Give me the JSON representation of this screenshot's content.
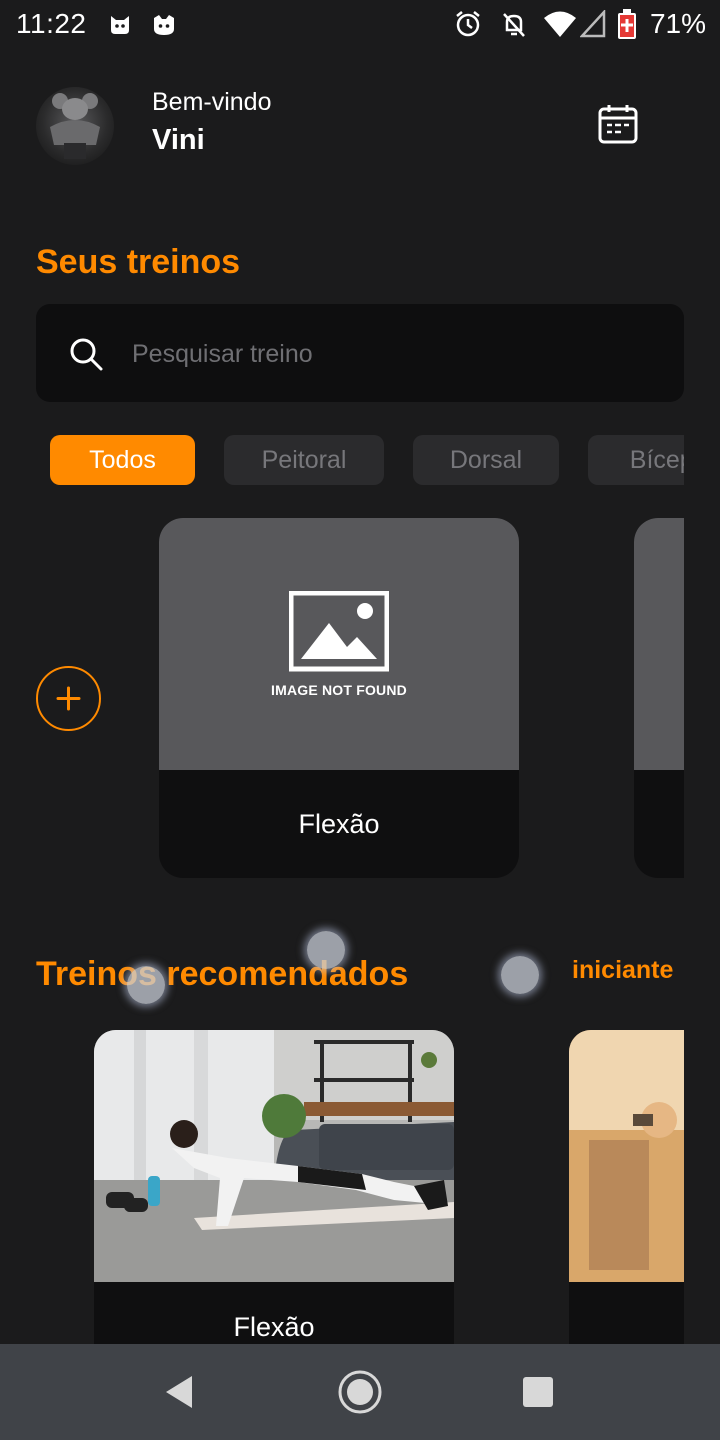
{
  "status_bar": {
    "time": "11:22",
    "battery": "71%",
    "icons": [
      "cat-notification-icon",
      "cat-notification-icon",
      "alarm-icon",
      "notifications-off-icon",
      "wifi-icon",
      "signal-icon",
      "battery-icon"
    ]
  },
  "header": {
    "welcome": "Bem-vindo",
    "user_name": "Vini",
    "calendar_icon": "calendar-icon"
  },
  "workouts": {
    "title": "Seus treinos",
    "search": {
      "placeholder": "Pesquisar treino",
      "value": ""
    },
    "chips": [
      {
        "label": "Todos",
        "active": true
      },
      {
        "label": "Peitoral",
        "active": false
      },
      {
        "label": "Dorsal",
        "active": false
      },
      {
        "label": "Bíceps",
        "active": false
      }
    ],
    "add_icon": "plus-icon",
    "cards": [
      {
        "name": "Flexão",
        "image_status": "IMAGE NOT FOUND"
      }
    ]
  },
  "recommended": {
    "title": "Treinos recomendados",
    "level": "iniciante",
    "cards": [
      {
        "name": "Flexão"
      }
    ]
  },
  "colors": {
    "accent": "#ff8a00",
    "background": "#1b1b1c",
    "surface": "#0f0f10",
    "chip_inactive": "#2b2b2d",
    "nav_bar": "#404348"
  },
  "nav": {
    "back_icon": "back-icon",
    "home_icon": "home-icon",
    "recents_icon": "recents-icon"
  }
}
